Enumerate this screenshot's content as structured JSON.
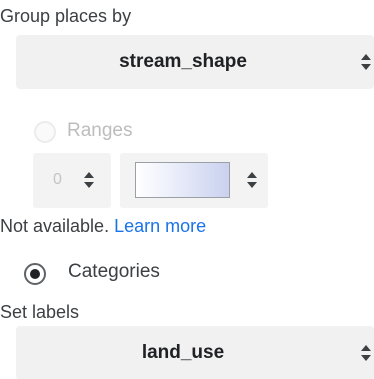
{
  "group_by": {
    "label": "Group places by",
    "selected": "stream_shape"
  },
  "ranges": {
    "label": "Ranges",
    "steps_value": "0",
    "not_available": "Not available.",
    "learn_more": "Learn more"
  },
  "categories": {
    "label": "Categories"
  },
  "set_labels": {
    "label": "Set labels",
    "selected": "land_use"
  },
  "colors": {
    "link": "#1a73e8",
    "disabled_text": "#bdbdbd",
    "select_bg": "#f1f1f1"
  },
  "icons": {
    "updown": "up-down-arrows-icon",
    "radio_checked": "radio-checked-icon",
    "radio_unchecked": "radio-unchecked-icon"
  }
}
